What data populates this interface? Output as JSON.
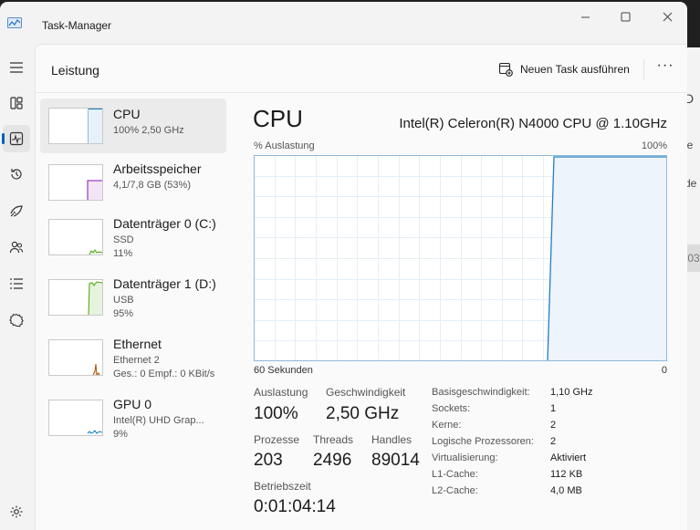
{
  "window": {
    "title": "Task-Manager",
    "min": "—",
    "max": "☐",
    "close": "✕"
  },
  "nav": {
    "icons": [
      "menu-icon",
      "processes-icon",
      "performance-icon",
      "app-history-icon",
      "startup-icon",
      "users-icon",
      "details-icon",
      "services-icon"
    ],
    "settings": "settings-icon"
  },
  "header": {
    "title": "Leistung",
    "new_task": "Neuen Task ausführen",
    "more": "···"
  },
  "sidebar": [
    {
      "title": "CPU",
      "line1": "100%  2,50 GHz",
      "line2": "",
      "line3": "",
      "color": "#117dbb"
    },
    {
      "title": "Arbeitsspeicher",
      "line1": "4,1/7,8 GB (53%)",
      "line2": "",
      "line3": "",
      "color": "#8b12ae"
    },
    {
      "title": "Datenträger 0 (C:)",
      "line1": "SSD",
      "line2": "11%",
      "line3": "",
      "color": "#4da60c"
    },
    {
      "title": "Datenträger 1 (D:)",
      "line1": "USB",
      "line2": "95%",
      "line3": "",
      "color": "#4da60c"
    },
    {
      "title": "Ethernet",
      "line1": "Ethernet 2",
      "line2": "Ges.: 0  Empf.: 0 KBit/s",
      "line3": "",
      "color": "#a74f01"
    },
    {
      "title": "GPU 0",
      "line1": "Intel(R) UHD Grap...",
      "line2": "9%",
      "line3": "",
      "color": "#0a7cc7"
    }
  ],
  "main": {
    "title": "CPU",
    "model": "Intel(R) Celeron(R) N4000 CPU @ 1.10GHz",
    "graph_label": "% Auslastung",
    "graph_max": "100%",
    "graph_xleft": "60 Sekunden",
    "graph_xright": "0",
    "stats": {
      "auslastung_lbl": "Auslastung",
      "auslastung": "100%",
      "geschw_lbl": "Geschwindigkeit",
      "geschw": "2,50 GHz",
      "prozesse_lbl": "Prozesse",
      "prozesse": "203",
      "threads_lbl": "Threads",
      "threads": "2496",
      "handles_lbl": "Handles",
      "handles": "89014",
      "betriebszeit_lbl": "Betriebszeit",
      "betriebszeit": "0:01:04:14"
    },
    "info": [
      {
        "label": "Basisgeschwindigkeit:",
        "value": "1,10 GHz"
      },
      {
        "label": "Sockets:",
        "value": "1"
      },
      {
        "label": "Kerne:",
        "value": "2"
      },
      {
        "label": "Logische Prozessoren:",
        "value": "2"
      },
      {
        "label": "Virtualisierung:",
        "value": "Aktiviert"
      },
      {
        "label": "L1-Cache:",
        "value": "112 KB"
      },
      {
        "label": "L2-Cache:",
        "value": "4,0 MB"
      }
    ]
  },
  "background_window": {
    "fragments": [
      "D",
      "ie",
      "de",
      ",03"
    ]
  }
}
